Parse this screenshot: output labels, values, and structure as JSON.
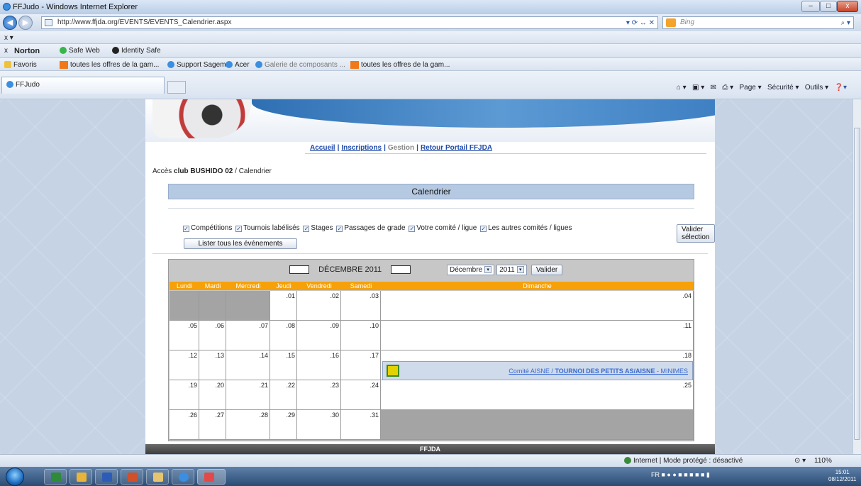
{
  "window": {
    "title": "FFJudo - Windows Internet Explorer",
    "min_label": "–",
    "max_label": "□",
    "close_label": "x"
  },
  "addressbar": {
    "url": "http://www.ffjda.org/EVENTS/EVENTS_Calendrier.aspx",
    "search_placeholder": "Bing",
    "tools_glyphs": "▾ ⟳ ↔ ✕",
    "search_glyph": "⌕ ▾"
  },
  "toolbars": {
    "row1_glyph": "x ▾",
    "norton_close": "x",
    "norton": "Norton",
    "safe_web": "Safe Web",
    "identity_safe": "Identity Safe",
    "favorites": "Favoris",
    "fav_items": [
      "toutes les offres de la gam...",
      "Support Sagem",
      "Acer",
      "Galerie de composants ...",
      "toutes les offres de la gam..."
    ]
  },
  "tab": {
    "label": "FFJudo"
  },
  "commandbar": {
    "page": "Page",
    "security": "Sécurité",
    "tools": "Outils"
  },
  "site": {
    "nav": {
      "accueil": "Accueil",
      "inscriptions": "Inscriptions",
      "gestion": "Gestion",
      "retour": "Retour Portail FFJDA",
      "separator": "|"
    },
    "breadcrumb": {
      "prefix": "Accès",
      "club": "club BUSHIDO 02",
      "suffix": "/ Calendrier"
    },
    "header": "Calendrier",
    "filters": [
      "Compétitions",
      "Tournois labélisés",
      "Stages",
      "Passages de grade",
      "Votre comité / ligue",
      "Les autres comités / ligues"
    ],
    "check_mark": "✓",
    "valider_selection": "Valider sélection",
    "lister_tous": "Lister tous les événements",
    "footer": "FFJDA"
  },
  "calendar": {
    "month_label": "DÉCEMBRE 2011",
    "month_select": "Décembre",
    "year_select": "2011",
    "dropdown_glyph": "▾",
    "valider": "Valider",
    "days": [
      "Lundi",
      "Mardi",
      "Mercredi",
      "Jeudi",
      "Vendredi",
      "Samedi",
      "Dimanche"
    ],
    "weeks": [
      [
        "",
        "",
        "",
        ".01",
        ".02",
        ".03",
        ".04"
      ],
      [
        ".05",
        ".06",
        ".07",
        ".08",
        ".09",
        ".10",
        ".11"
      ],
      [
        ".12",
        ".13",
        ".14",
        ".15",
        ".16",
        ".17",
        ".18"
      ],
      [
        ".19",
        ".20",
        ".21",
        ".22",
        ".23",
        ".24",
        ".25"
      ],
      [
        ".26",
        ".27",
        ".28",
        ".29",
        ".30",
        ".31",
        ""
      ]
    ],
    "event": {
      "committee": "Comité AISNE /",
      "title": "TOURNOI DES PETITS AS/AISNE",
      "category": "- MINIMES"
    }
  },
  "statusbar": {
    "zone": "Internet | Mode protégé : désactivé",
    "zoom": "110%",
    "zoom_glyph": "⊙ ▾"
  },
  "taskbar": {
    "tray": "FR",
    "time": "15:01",
    "date": "08/12/2011"
  }
}
